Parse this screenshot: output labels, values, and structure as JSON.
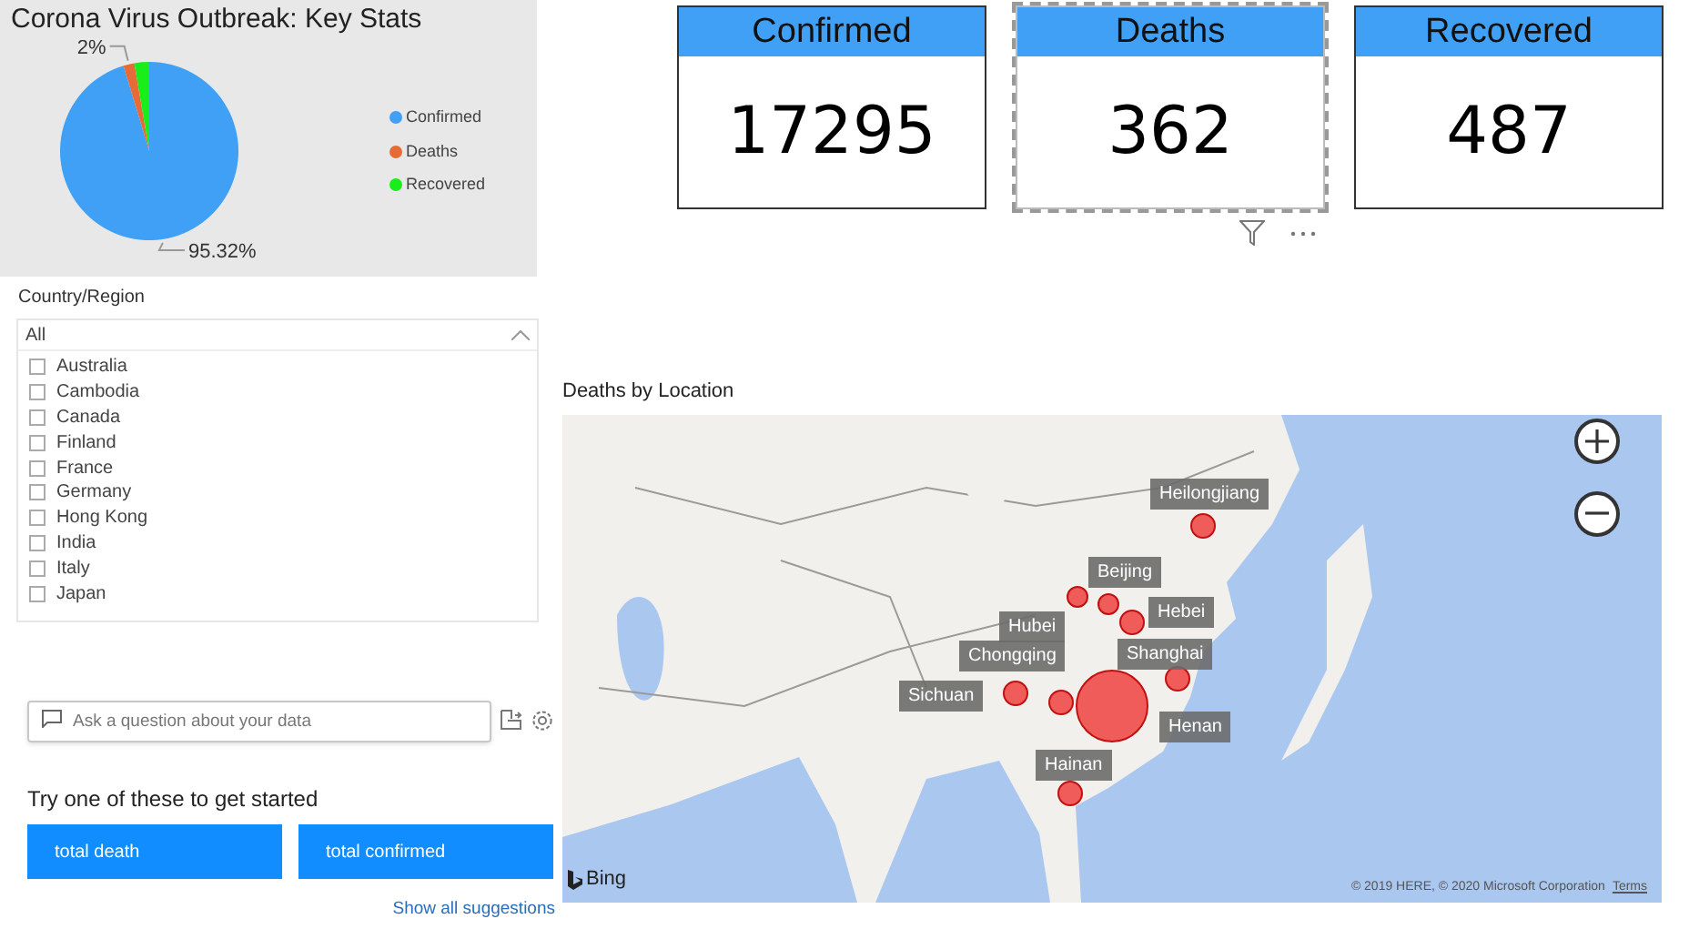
{
  "pie_panel": {
    "title": "Corona Virus Outbreak: Key Stats",
    "chart_data": {
      "type": "pie",
      "categories": [
        "Confirmed",
        "Deaths",
        "Recovered"
      ],
      "values": [
        95.32,
        2.0,
        2.68
      ],
      "colors": [
        "#3fa0f5",
        "#e66c37",
        "#1aee1a"
      ],
      "value_labels": [
        "95.32%",
        "2%",
        null
      ]
    }
  },
  "cards": [
    {
      "title": "Confirmed",
      "value": "17295",
      "selected": false
    },
    {
      "title": "Deaths",
      "value": "362",
      "selected": true
    },
    {
      "title": "Recovered",
      "value": "487",
      "selected": false
    }
  ],
  "slicer": {
    "title": "Country/Region",
    "header": "All",
    "expanded": true,
    "items": [
      {
        "label": "Australia",
        "checked": false
      },
      {
        "label": "Cambodia",
        "checked": false
      },
      {
        "label": "Canada",
        "checked": false
      },
      {
        "label": "Finland",
        "checked": false
      },
      {
        "label": "France",
        "checked": false
      },
      {
        "label": "Germany",
        "checked": false
      },
      {
        "label": "Hong Kong",
        "checked": false
      },
      {
        "label": "India",
        "checked": false
      },
      {
        "label": "Italy",
        "checked": false
      },
      {
        "label": "Japan",
        "checked": false
      }
    ]
  },
  "qna": {
    "placeholder": "Ask a question about your data",
    "prompt": "Try one of these to get started",
    "suggestions": [
      "total death",
      "total confirmed"
    ],
    "show_all": "Show all suggestions"
  },
  "map": {
    "title": "Deaths by Location",
    "bubbles": [
      {
        "label": "Heilongjiang"
      },
      {
        "label": "Beijing"
      },
      {
        "label": "Hebei"
      },
      {
        "label": "Hubei"
      },
      {
        "label": "Shanghai"
      },
      {
        "label": "Chongqing"
      },
      {
        "label": "Sichuan"
      },
      {
        "label": "Henan"
      },
      {
        "label": "Hainan"
      }
    ],
    "logo": "Bing",
    "attribution": "© 2019 HERE, © 2020 Microsoft Corporation",
    "terms": "Terms"
  }
}
